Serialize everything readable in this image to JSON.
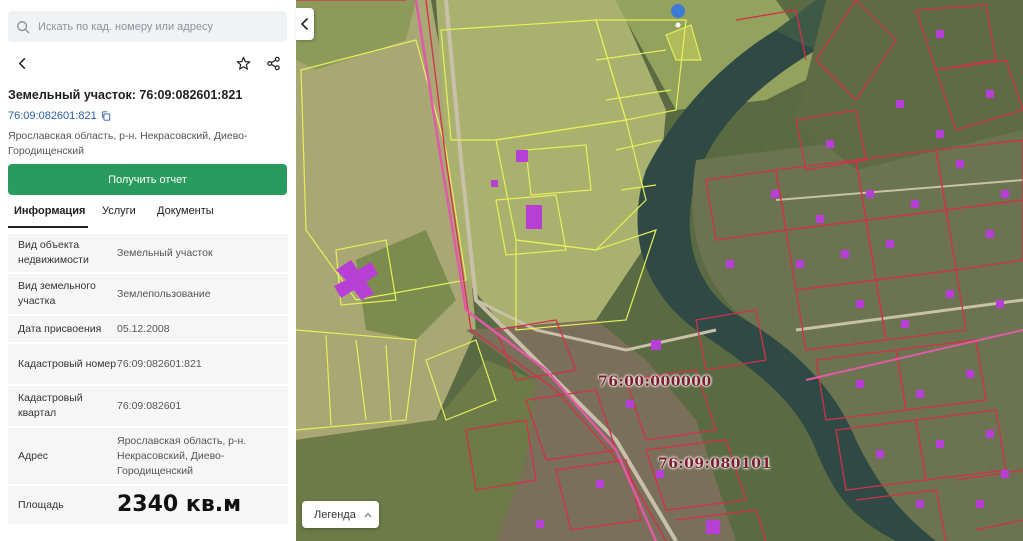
{
  "search": {
    "placeholder": "Искать по кад. номеру или адресу"
  },
  "toolbar": {
    "back_icon": "back-arrow-icon",
    "favorite_icon": "star-icon",
    "share_icon": "share-icon"
  },
  "parcel": {
    "title": "Земельный участок: 76:09:082601:821",
    "cad_number": "76:09:082601:821",
    "address": "Ярославская область, р-н. Некрасовский, Диево-Городищенский"
  },
  "actions": {
    "report_label": "Получить отчет"
  },
  "tabs": [
    {
      "label": "Информация",
      "active": true
    },
    {
      "label": "Услуги",
      "active": false
    },
    {
      "label": "Документы",
      "active": false
    }
  ],
  "info": {
    "rows": [
      {
        "key": "Вид объекта недвижимости",
        "value": "Земельный участок"
      },
      {
        "key": "Вид земельного участка",
        "value": "Землепользование"
      },
      {
        "key": "Дата присвоения",
        "value": "05.12.2008"
      },
      {
        "key": "Кадастровый номер",
        "value": "76:09:082601:821"
      },
      {
        "key": "Кадастровый квартал",
        "value": "76:09:082601"
      },
      {
        "key": "Адрес",
        "value": "Ярославская область, р-н. Некрасовский, Диево-Городищенский"
      },
      {
        "key": "Площадь",
        "value": "2340 кв.м"
      }
    ]
  },
  "map": {
    "labels": {
      "district": "76:00:000000",
      "quarter": "76:09:080101"
    },
    "legend_label": "Легенда",
    "colors": {
      "parcel_outline": "#e8ee5a",
      "quarter_outline": "#d2314a",
      "building_fill": "#b73fd6",
      "accent_green": "#2a9b5e"
    }
  }
}
